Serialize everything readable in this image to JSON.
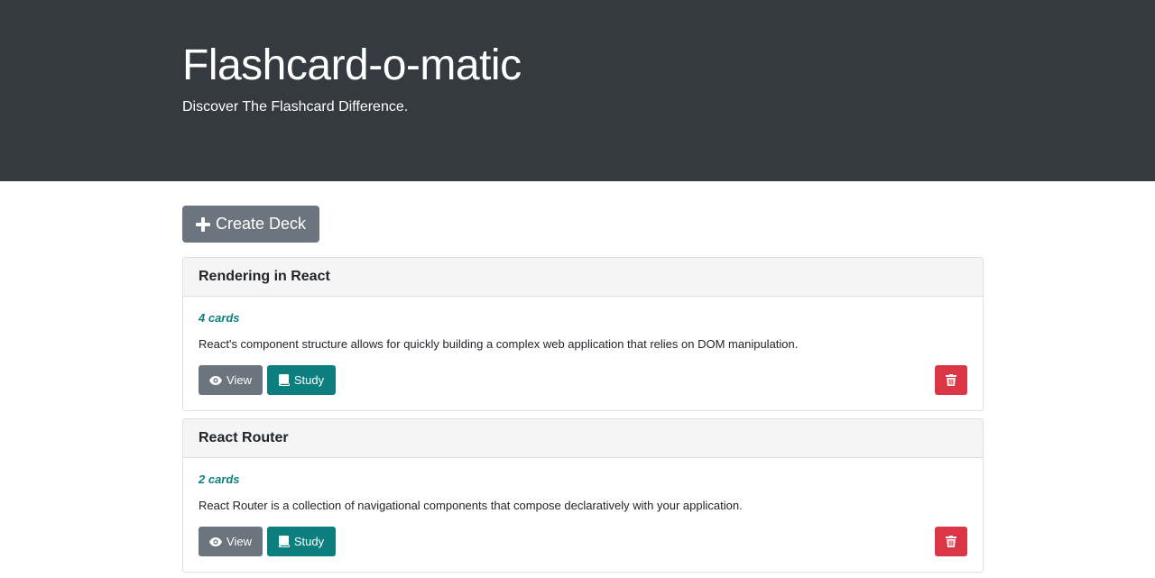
{
  "header": {
    "title": "Flashcard-o-matic",
    "subtitle": "Discover The Flashcard Difference."
  },
  "toolbar": {
    "create_label": "Create Deck",
    "create_icon": "plus-icon"
  },
  "decks": [
    {
      "name": "Rendering in React",
      "count_label": "4 cards",
      "description": "React's component structure allows for quickly building a complex web application that relies on DOM manipulation.",
      "view_label": "View",
      "study_label": "Study"
    },
    {
      "name": "React Router",
      "count_label": "2 cards",
      "description": "React Router is a collection of navigational components that compose declaratively with your application.",
      "view_label": "View",
      "study_label": "Study"
    }
  ],
  "icons": {
    "view": "eye-icon",
    "study": "book-icon",
    "delete": "trash-icon"
  },
  "colors": {
    "header_bg": "#343a40",
    "secondary": "#6c757d",
    "study": "#0c7e7e",
    "danger": "#dc3545",
    "card_header_bg": "#f5f5f5"
  }
}
